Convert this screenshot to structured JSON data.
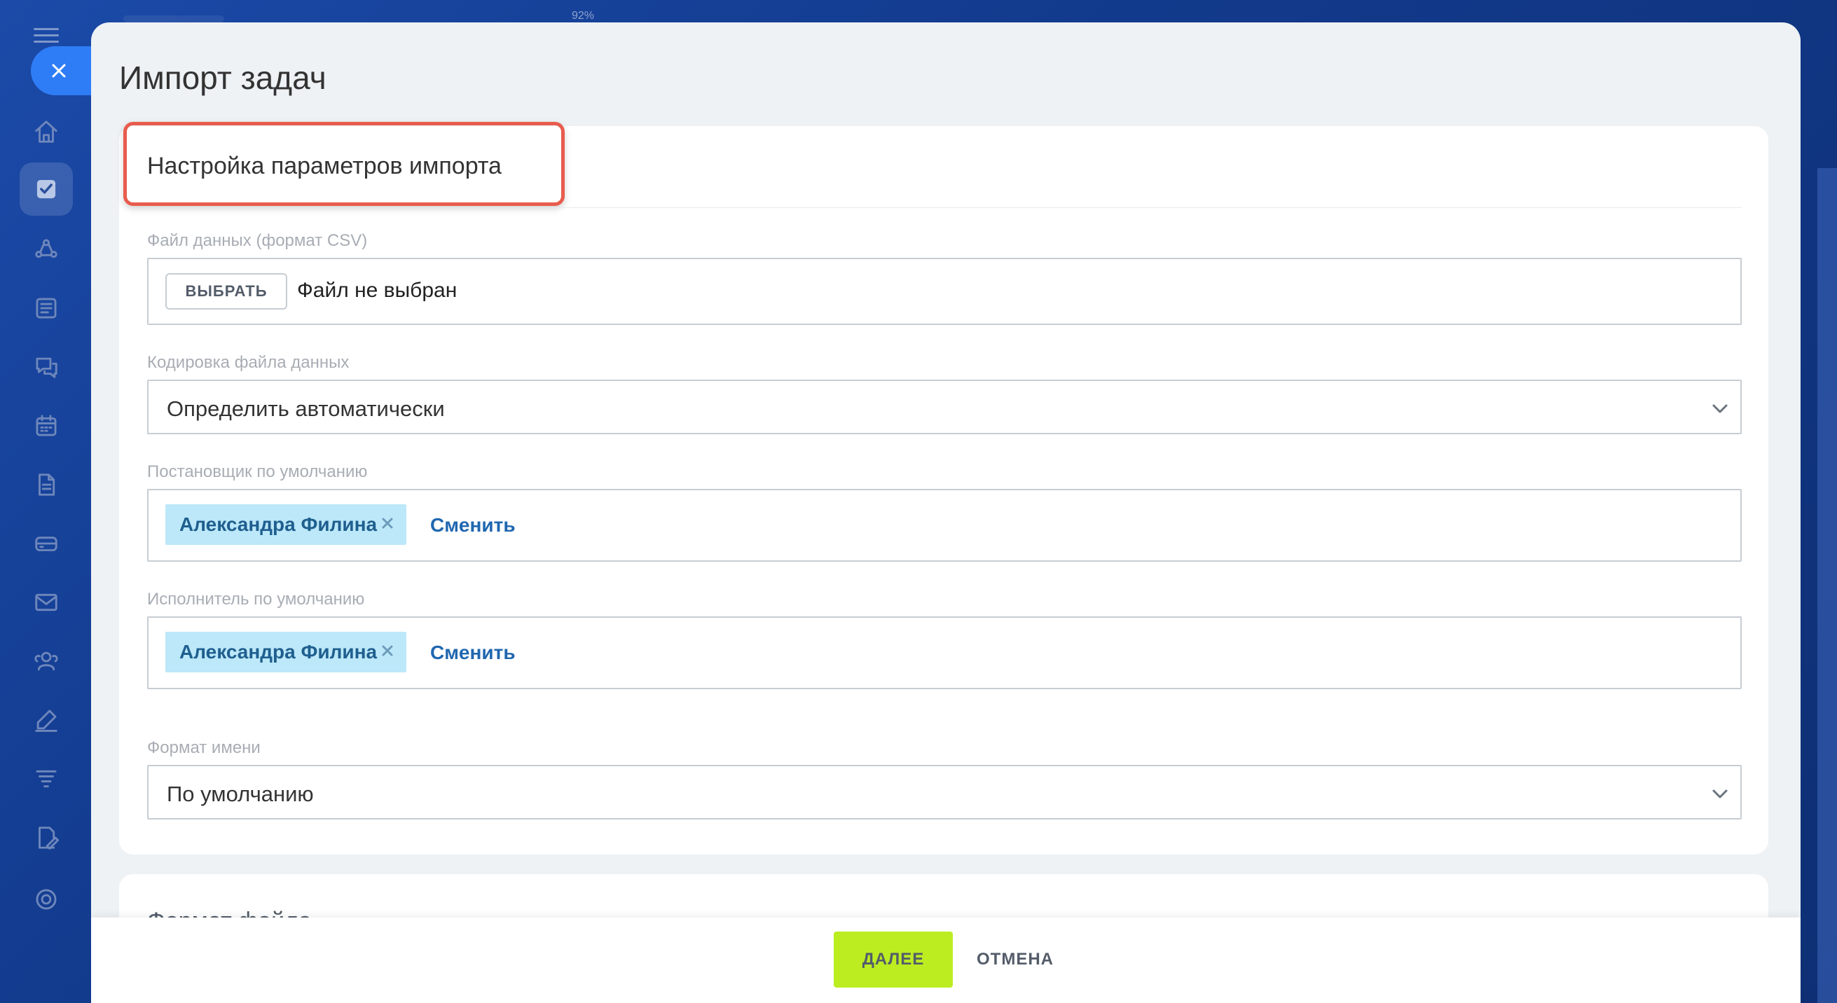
{
  "top_zoom": "92%",
  "sidebar": {
    "icons": [
      "menu-icon",
      "home-icon",
      "tasks-icon",
      "crm-icon",
      "feed-icon",
      "chat-icon",
      "calendar-icon",
      "documents-icon",
      "drive-icon",
      "mail-icon",
      "groups-icon",
      "sign-icon",
      "funnel-icon",
      "edit-doc-icon",
      "settings-icon"
    ]
  },
  "panel": {
    "title": "Импорт задач",
    "section_title": "Настройка параметров импорта",
    "file": {
      "label": "Файл данных (формат CSV)",
      "button": "ВЫБРАТЬ",
      "status": "Файл не выбран"
    },
    "encoding": {
      "label": "Кодировка файла данных",
      "value": "Определить автоматически"
    },
    "creator": {
      "label": "Постановщик по умолчанию",
      "user": "Александра Филина",
      "change": "Сменить"
    },
    "responsible": {
      "label": "Исполнитель по умолчанию",
      "user": "Александра Филина",
      "change": "Сменить"
    },
    "name_format": {
      "label": "Формат имени",
      "value": "По умолчанию"
    },
    "next_section_title": "Формат файла"
  },
  "footer": {
    "next": "ДАЛЕЕ",
    "cancel": "ОТМЕНА"
  },
  "colors": {
    "highlight": "#e85c4d",
    "next_button": "#bbed21",
    "tag_bg": "#bce8f9",
    "link": "#2067b0"
  }
}
